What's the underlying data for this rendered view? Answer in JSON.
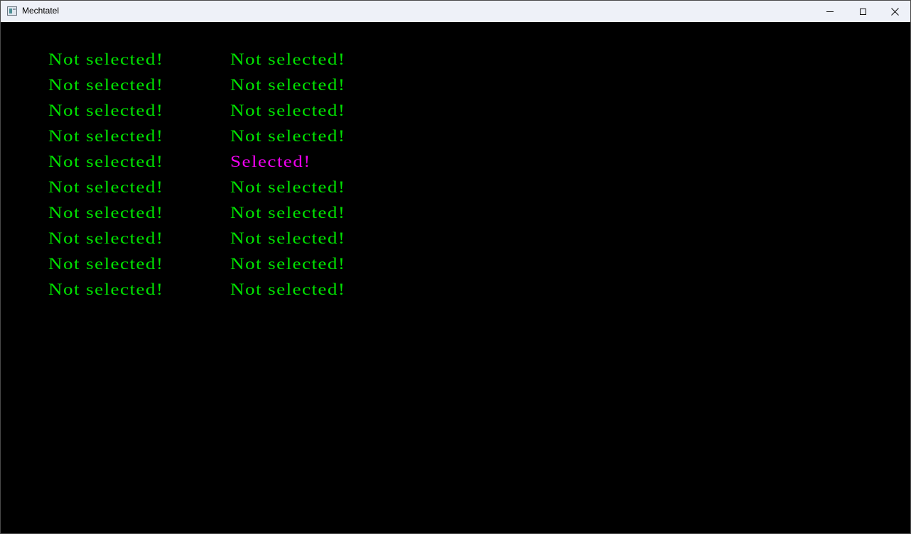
{
  "window": {
    "title": "Mechtatel",
    "controls": {
      "minimize_icon": "minimize-icon",
      "maximize_icon": "maximize-icon",
      "close_icon": "close-icon"
    }
  },
  "colors": {
    "background": "#000000",
    "not_selected": "#00e000",
    "selected": "#ee00ee"
  },
  "grid": {
    "columns": [
      [
        "Not selected!",
        "Not selected!",
        "Not selected!",
        "Not selected!",
        "Not selected!",
        "Not selected!",
        "Not selected!",
        "Not selected!",
        "Not selected!",
        "Not selected!"
      ],
      [
        "Not selected!",
        "Not selected!",
        "Not selected!",
        "Not selected!",
        "Selected!",
        "Not selected!",
        "Not selected!",
        "Not selected!",
        "Not selected!",
        "Not selected!"
      ]
    ],
    "selected": {
      "column": 1,
      "row": 4
    }
  }
}
